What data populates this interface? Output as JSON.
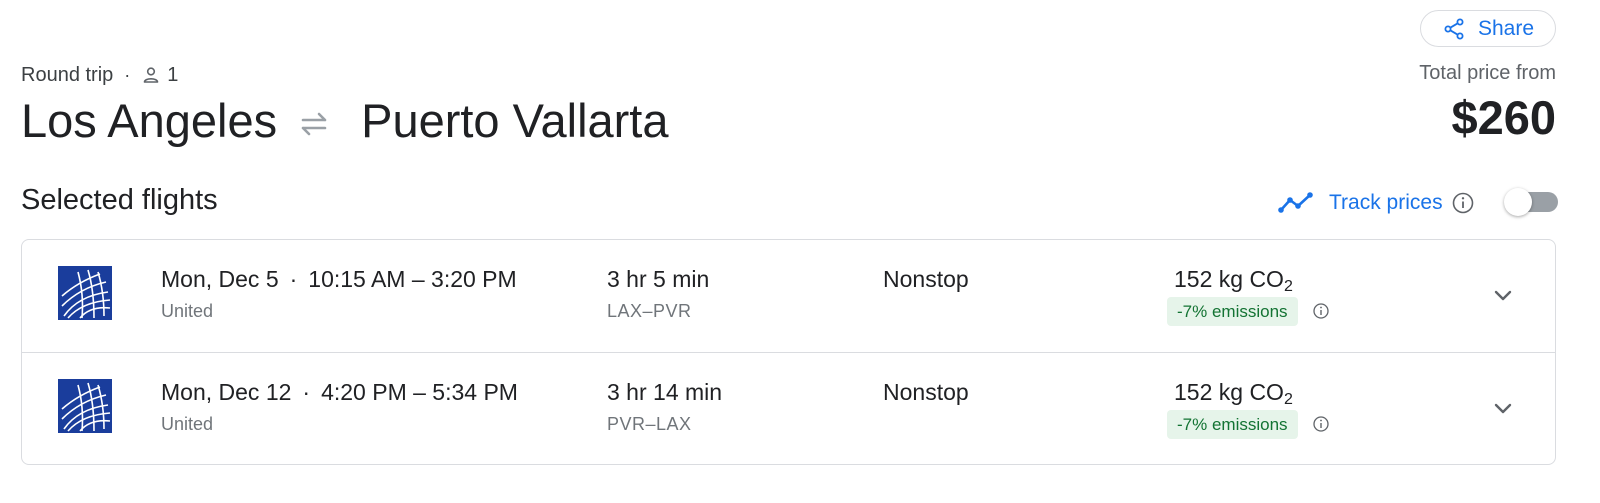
{
  "header": {
    "share_label": "Share",
    "trip_type": "Round trip",
    "passengers": "1",
    "origin": "Los Angeles",
    "destination": "Puerto Vallarta",
    "total_label": "Total price from",
    "total_price": "$260"
  },
  "selected": {
    "title": "Selected flights",
    "track_prices_label": "Track prices",
    "track_prices_on": false
  },
  "flights": [
    {
      "date": "Mon, Dec 5",
      "times": "10:15 AM – 3:20 PM",
      "airline": "United",
      "duration": "3 hr 5 min",
      "airports": "LAX–PVR",
      "stops": "Nonstop",
      "emissions_value": "152 kg CO",
      "emissions_sub": "2",
      "emissions_badge": "-7% emissions"
    },
    {
      "date": "Mon, Dec 12",
      "times": "4:20 PM – 5:34 PM",
      "airline": "United",
      "duration": "3 hr 14 min",
      "airports": "PVR–LAX",
      "stops": "Nonstop",
      "emissions_value": "152 kg CO",
      "emissions_sub": "2",
      "emissions_badge": "-7% emissions"
    }
  ],
  "icons": {
    "share": "share-icon",
    "person": "person-icon",
    "swap": "swap-arrows-icon",
    "trend": "trend-line-icon",
    "info": "info-icon",
    "expand": "chevron-down-icon",
    "airline_logo": "united-globe-logo"
  },
  "colors": {
    "accent": "#1a73e8",
    "badge_bg": "#e6f4ea",
    "badge_text": "#137333",
    "united_blue": "#1a3d9c"
  }
}
